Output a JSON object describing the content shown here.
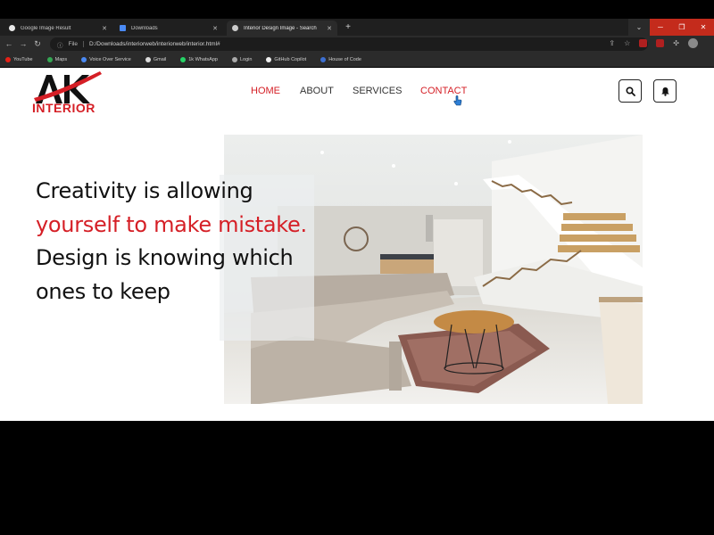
{
  "browser": {
    "tabs": [
      {
        "label": "Google Image Result",
        "favicon_color": "#e8e8e8",
        "active": false
      },
      {
        "label": "Downloads",
        "favicon_color": "#4a8af4",
        "active": false
      },
      {
        "label": "Interior Design Image - Search",
        "favicon_color": "#cccccc",
        "active": true
      }
    ],
    "new_tab": "+",
    "address": {
      "file_label": "File",
      "url": "D:/Downloads/interiorweb/interiorweb/interior.html#"
    },
    "bookmarks": [
      {
        "label": "YouTube",
        "color": "#e62117"
      },
      {
        "label": "Maps",
        "color": "#34a853"
      },
      {
        "label": "Voice Over Service",
        "color": "#4a8af4"
      },
      {
        "label": "Gmail",
        "color": "#dddddd"
      },
      {
        "label": "1k WhatsApp",
        "color": "#25d366"
      },
      {
        "label": "Login",
        "color": "#aaaaaa"
      },
      {
        "label": "GitHub Copilot",
        "color": "#f0f0f0"
      },
      {
        "label": "House of Code",
        "color": "#3c6fd1"
      }
    ]
  },
  "site": {
    "logo_word": "INTERIOR",
    "nav": {
      "home": "HOME",
      "about": "ABOUT",
      "services": "SERVICES",
      "contact": "CONTACT"
    },
    "headline": {
      "part1": "Creativity is allowing",
      "part2_red": "yourself to make mistake.",
      "part3": "Design is knowing which ones to keep"
    },
    "accent_color": "#d51f26"
  }
}
